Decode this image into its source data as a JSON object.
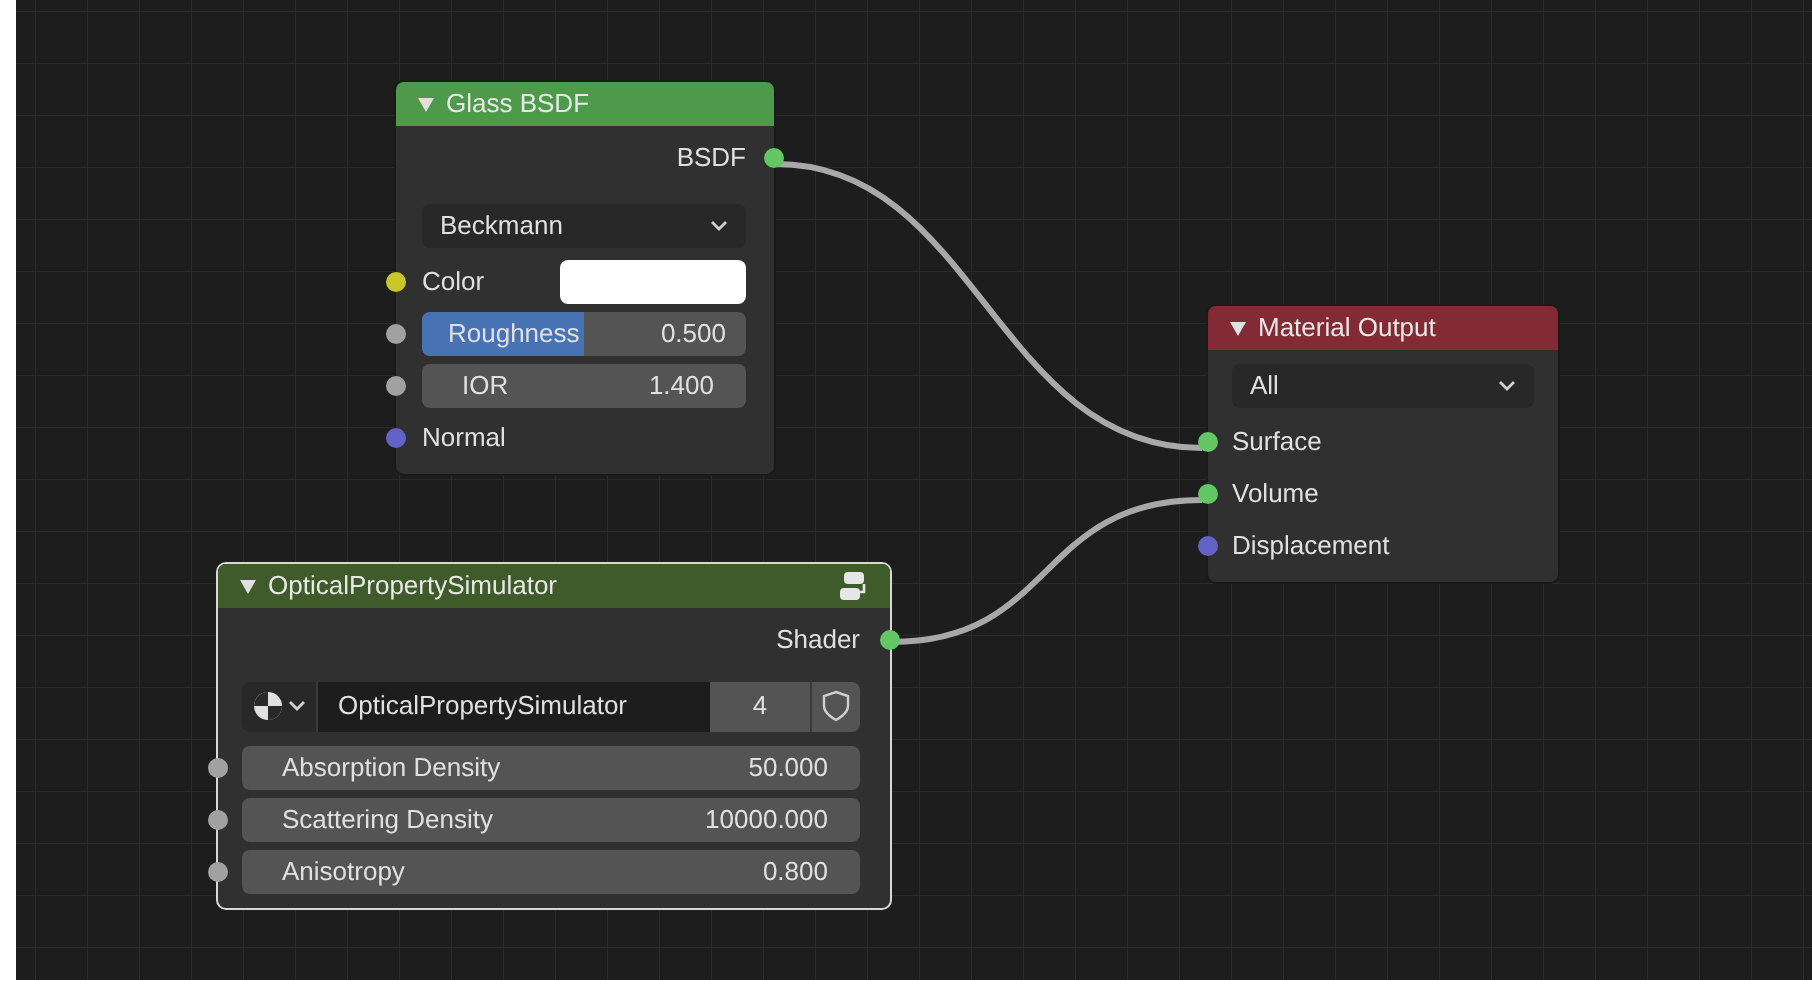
{
  "nodes": [
    {
      "kind": "shader",
      "title": "Glass BSDF",
      "color": "#4c9a4a",
      "selected": false,
      "rows": [
        {
          "kind": "output",
          "label": "BSDF",
          "socket": {
            "color": "#63c763"
          }
        },
        {
          "kind": "dropdown",
          "value": "Beckmann"
        },
        {
          "kind": "color",
          "label": "Color",
          "socket": {
            "color": "#c7c729"
          },
          "color": "#ffffff"
        },
        {
          "kind": "slider",
          "label": "Roughness",
          "value": "0.500",
          "level": 0.5,
          "socket": {
            "color": "#a1a1a1"
          }
        },
        {
          "kind": "field",
          "label": "IOR",
          "value": "1.400",
          "socket": {
            "color": "#a1a1a1"
          }
        },
        {
          "kind": "input",
          "label": "Normal",
          "socket": {
            "color": "#6363c7"
          }
        }
      ]
    },
    {
      "kind": "output",
      "title": "Material Output",
      "color": "#832b34",
      "selected": false,
      "rows": [
        {
          "kind": "dropdown",
          "value": "All"
        },
        {
          "kind": "input",
          "label": "Surface",
          "socket": {
            "color": "#63c763"
          }
        },
        {
          "kind": "input",
          "label": "Volume",
          "socket": {
            "color": "#63c763"
          }
        },
        {
          "kind": "input",
          "label": "Displacement",
          "socket": {
            "color": "#6363c7"
          }
        }
      ]
    },
    {
      "kind": "group",
      "title": "OpticalPropertySimulator",
      "color": "#3e5b29",
      "selected": true,
      "rows": [
        {
          "kind": "output",
          "label": "Shader",
          "socket": {
            "color": "#63c763"
          }
        },
        {
          "kind": "datablock",
          "value": "OpticalPropertySimulator",
          "users": "4"
        },
        {
          "kind": "field",
          "label": "Absorption Density",
          "value": "50.000",
          "socket": {
            "color": "#a1a1a1"
          }
        },
        {
          "kind": "field",
          "label": "Scattering Density",
          "value": "10000.000",
          "socket": {
            "color": "#a1a1a1"
          }
        },
        {
          "kind": "field",
          "label": "Anisotropy",
          "value": "0.800",
          "socket": {
            "color": "#a1a1a1"
          }
        }
      ]
    }
  ]
}
